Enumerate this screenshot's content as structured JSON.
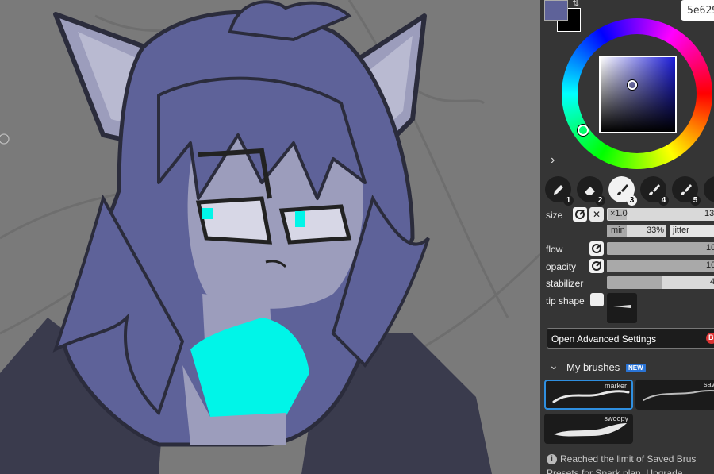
{
  "color": {
    "primary": "#5e6299",
    "secondary": "#000000",
    "hex_display": "5e629",
    "swap_glyph": "⇅",
    "hue_accent": "#1c1cd9"
  },
  "expand_glyph": "›",
  "tools": [
    {
      "icon": "pen-icon",
      "number": "1",
      "active": false
    },
    {
      "icon": "eraser-icon",
      "number": "2",
      "active": false
    },
    {
      "icon": "brush-icon",
      "number": "3",
      "active": true
    },
    {
      "icon": "brush-icon",
      "number": "4",
      "active": false
    },
    {
      "icon": "brush-icon",
      "number": "5",
      "active": false
    }
  ],
  "brush_settings": {
    "size": {
      "label": "size",
      "multiplier": "×1.0",
      "value": "13",
      "reset_glyph": "✕"
    },
    "min": {
      "label": "min",
      "value": "33%",
      "fill": 0.33
    },
    "jitter": {
      "label": "jitter"
    },
    "flow": {
      "label": "flow",
      "value": "10",
      "fill": 1.0
    },
    "opacity": {
      "label": "opacity",
      "value": "10",
      "fill": 1.0
    },
    "stabilizer": {
      "label": "stabilizer",
      "value": "4",
      "fill": 0.5
    },
    "tip_shape": {
      "label": "tip shape"
    }
  },
  "advanced_button": {
    "label": "Open Advanced Settings",
    "badge": "B"
  },
  "my_brushes": {
    "title": "My brushes",
    "new_badge": "NEW",
    "collapse_glyph": "⌄",
    "items": [
      {
        "name": "marker",
        "selected": true
      },
      {
        "name": "sav",
        "selected": false
      },
      {
        "name": "swoopy",
        "selected": false
      }
    ]
  },
  "info": {
    "glyph": "i",
    "line1": "Reached the limit of Saved Brus",
    "line2": "Presets for Spark plan. Upgrade"
  }
}
